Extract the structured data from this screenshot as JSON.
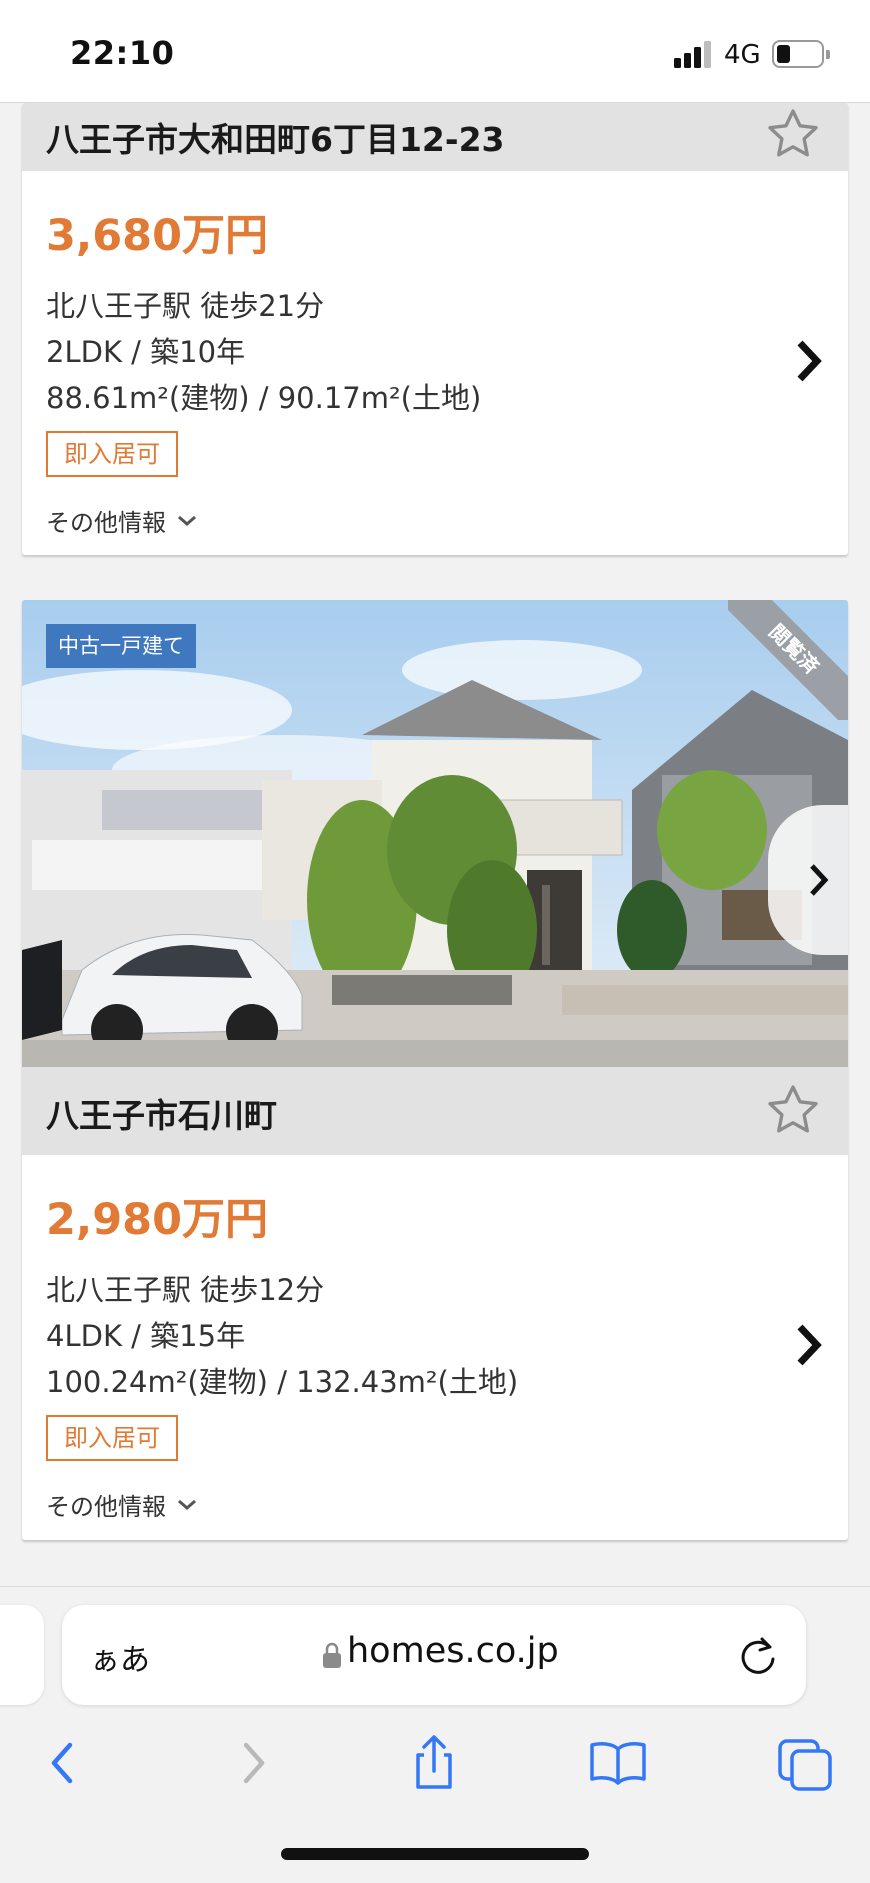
{
  "status_bar": {
    "time": "22:10",
    "network": "4G",
    "battery_level": 0.3
  },
  "listings": [
    {
      "address": "八王子市大和田町6丁目12-23",
      "price": "3,680万円",
      "station": "北八王子駅 徒歩21分",
      "layout_age": "2LDK  / 築10年",
      "area": "88.61m²(建物)  / 90.17m²(土地)",
      "tag": "即入居可",
      "more_info": "その他情報"
    },
    {
      "property_type": "中古一戸建て",
      "viewed_label": "閲覧済",
      "address": "八王子市石川町",
      "price": "2,980万円",
      "station": "北八王子駅 徒歩12分",
      "layout_age": "4LDK  / 築15年",
      "area": "100.24m²(建物)  / 132.43m²(土地)",
      "tag": "即入居可",
      "more_info": "その他情報"
    }
  ],
  "browser": {
    "text_size_label": "ぁあ",
    "url": "homes.co.jp"
  },
  "colors": {
    "price": "#e07a35",
    "type_badge": "#3f78bf",
    "ios_blue": "#3478f6"
  },
  "icons": [
    "star-icon",
    "chevron-right-icon",
    "chevron-down-icon",
    "lock-icon",
    "reload-icon",
    "back-icon",
    "forward-icon",
    "share-icon",
    "bookmarks-icon",
    "tabs-icon"
  ]
}
